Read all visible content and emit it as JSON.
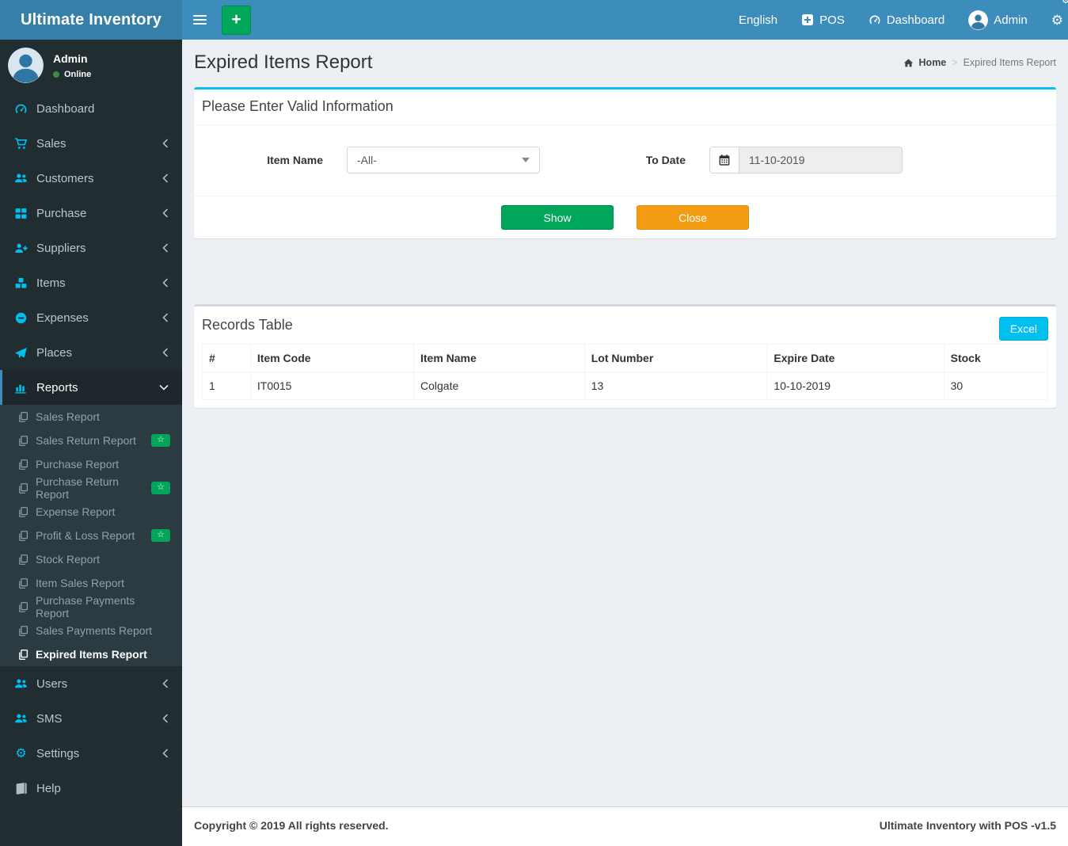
{
  "app": {
    "brand": "Ultimate Inventory",
    "footer_left": "Copyright © 2019 All rights reserved.",
    "footer_right": "Ultimate Inventory with POS -v1.5"
  },
  "icons": {
    "plus": "+",
    "star": "☆",
    "gear": "⚙"
  },
  "colors": {
    "navbar": "#3c8dbc",
    "logo_bg": "#367fa9",
    "sidebar_bg": "#222d32",
    "submenu_bg": "#2c3b41",
    "accent_cyan": "#00c0ef",
    "green": "#00a65a",
    "orange": "#f39c12",
    "content_bg": "#ecf0f5"
  },
  "navbar": {
    "language": "English",
    "pos": "POS",
    "dashboard": "Dashboard",
    "user": "Admin"
  },
  "user_panel": {
    "name": "Admin",
    "status": "Online"
  },
  "sidebar": {
    "items": [
      {
        "label": "Dashboard"
      },
      {
        "label": "Sales"
      },
      {
        "label": "Customers"
      },
      {
        "label": "Purchase"
      },
      {
        "label": "Suppliers"
      },
      {
        "label": "Items"
      },
      {
        "label": "Expenses"
      },
      {
        "label": "Places"
      },
      {
        "label": "Reports",
        "children": [
          {
            "label": "Sales Report"
          },
          {
            "label": "Sales Return Report",
            "badge": true
          },
          {
            "label": "Purchase Report"
          },
          {
            "label": "Purchase Return Report",
            "badge": true
          },
          {
            "label": "Expense Report"
          },
          {
            "label": "Profit & Loss Report",
            "badge": true
          },
          {
            "label": "Stock Report"
          },
          {
            "label": "Item Sales Report"
          },
          {
            "label": "Purchase Payments Report"
          },
          {
            "label": "Sales Payments Report"
          },
          {
            "label": "Expired Items Report",
            "active": true
          }
        ]
      },
      {
        "label": "Users"
      },
      {
        "label": "SMS"
      },
      {
        "label": "Settings"
      },
      {
        "label": "Help"
      }
    ]
  },
  "page": {
    "title": "Expired Items Report",
    "breadcrumb_home": "Home",
    "breadcrumb_current": "Expired Items Report"
  },
  "filter": {
    "panel_title": "Please Enter Valid Information",
    "item_name_label": "Item Name",
    "item_name_value": "-All-",
    "to_date_label": "To Date",
    "to_date_value": "11-10-2019",
    "show": "Show",
    "close": "Close"
  },
  "records": {
    "panel_title": "Records Table",
    "excel": "Excel",
    "columns": [
      "#",
      "Item Code",
      "Item Name",
      "Lot Number",
      "Expire Date",
      "Stock"
    ],
    "rows": [
      {
        "num": "1",
        "item_code": "IT0015",
        "item_name": "Colgate",
        "lot_number": "13",
        "expire_date": "10-10-2019",
        "stock": "30"
      }
    ]
  }
}
